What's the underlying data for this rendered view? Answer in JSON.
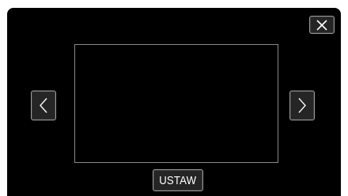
{
  "buttons": {
    "set_label": "USTAW"
  },
  "icons": {
    "close": "close-icon",
    "prev": "chevron-left-icon",
    "next": "chevron-right-icon"
  },
  "colors": {
    "background": "#000000",
    "button_fill": "#252525",
    "button_border": "#9a9a9a",
    "frame_border": "#8a8a8a",
    "text": "#ffffff"
  }
}
